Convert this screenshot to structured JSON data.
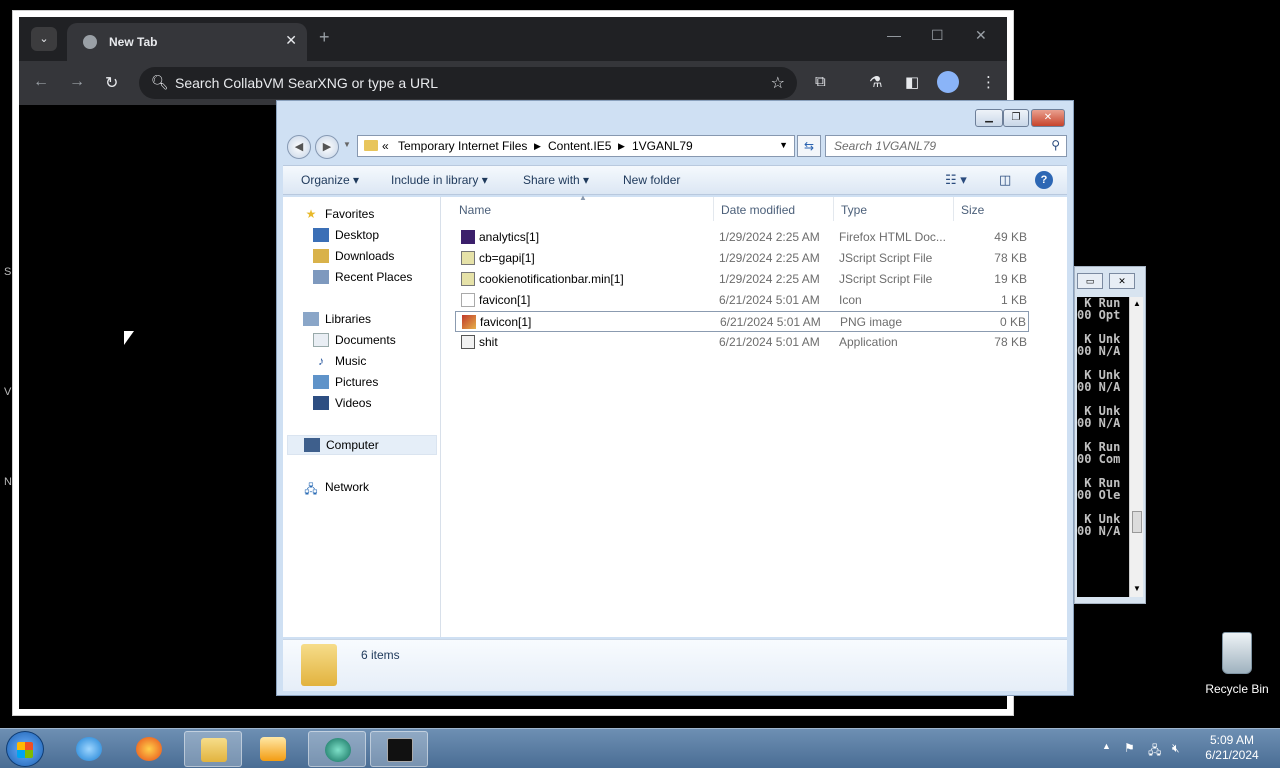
{
  "desktop": {
    "edge_letters": [
      "S",
      "V",
      "N"
    ],
    "recycle_bin_label": "Recycle Bin"
  },
  "chrome": {
    "tab_title": "New Tab",
    "omnibox_placeholder": "Search CollabVM SearXNG or type a URL",
    "icons": [
      "tab-search-icon",
      "globe-icon",
      "close-icon",
      "plus-icon",
      "minimize-icon",
      "maximize-icon",
      "close-window-icon",
      "back-icon",
      "forward-icon",
      "reload-icon",
      "search-icon",
      "star-icon",
      "extensions-icon",
      "labs-icon",
      "side-panel-icon",
      "profile-icon",
      "menu-icon"
    ]
  },
  "explorer": {
    "breadcrumb": {
      "overflow": "«",
      "items": [
        "Temporary Internet Files",
        "Content.IE5",
        "1VGANL79"
      ]
    },
    "search_placeholder": "Search 1VGANL79",
    "commands": {
      "organize": "Organize",
      "include_in_library": "Include in library",
      "share_with": "Share with",
      "new_folder": "New folder"
    },
    "nav": {
      "favorites": "Favorites",
      "desktop": "Desktop",
      "downloads": "Downloads",
      "recent_places": "Recent Places",
      "libraries": "Libraries",
      "documents": "Documents",
      "music": "Music",
      "pictures": "Pictures",
      "videos": "Videos",
      "computer": "Computer",
      "network": "Network"
    },
    "columns": {
      "name": "Name",
      "date_modified": "Date modified",
      "type": "Type",
      "size": "Size"
    },
    "files": [
      {
        "name": "analytics[1]",
        "date": "1/29/2024 2:25 AM",
        "type": "Firefox HTML Doc...",
        "size": "49 KB"
      },
      {
        "name": "cb=gapi[1]",
        "date": "1/29/2024 2:25 AM",
        "type": "JScript Script File",
        "size": "78 KB"
      },
      {
        "name": "cookienotificationbar.min[1]",
        "date": "1/29/2024 2:25 AM",
        "type": "JScript Script File",
        "size": "19 KB"
      },
      {
        "name": "favicon[1]",
        "date": "6/21/2024 5:01 AM",
        "type": "Icon",
        "size": "1 KB"
      },
      {
        "name": "favicon[1]",
        "date": "6/21/2024 5:01 AM",
        "type": "PNG image",
        "size": "0 KB"
      },
      {
        "name": "shit",
        "date": "6/21/2024 5:01 AM",
        "type": "Application",
        "size": "78 KB"
      }
    ],
    "status": "6 items"
  },
  "console": {
    "text": " K Run\n00 Opt\n\n K Unk\n00 N/A\n\n K Unk\n00 N/A\n\n K Unk\n00 N/A\n\n K Run\n00 Com\n\n K Run\n00 Ole\n\n K Unk\n00 N/A"
  },
  "taskbar": {
    "time": "5:09 AM",
    "date": "6/21/2024"
  }
}
